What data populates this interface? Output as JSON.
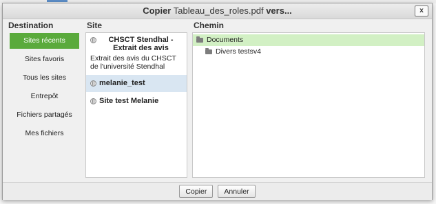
{
  "dialog": {
    "title_action": "Copier",
    "title_file": "Tableau_des_roles.pdf",
    "title_target": "vers...",
    "close_label": "x"
  },
  "columns": {
    "destination": "Destination",
    "site": "Site",
    "chemin": "Chemin"
  },
  "destination_items": [
    {
      "label": "Sites récents",
      "active": true
    },
    {
      "label": "Sites favoris",
      "active": false
    },
    {
      "label": "Tous les sites",
      "active": false
    },
    {
      "label": "Entrepôt",
      "active": false
    },
    {
      "label": "Fichiers partagés",
      "active": false
    },
    {
      "label": "Mes fichiers",
      "active": false
    }
  ],
  "sites": [
    {
      "name": "CHSCT Stendhal - Extrait des avis",
      "description": "Extrait des avis du CHSCT de l'université Stendhal",
      "icon": "site-globe-icon",
      "selected": false
    },
    {
      "name": "melanie_test",
      "description": "",
      "icon": "site-globe-icon",
      "selected": true
    },
    {
      "name": "Site test Melanie",
      "description": "",
      "icon": "site-globe-icon",
      "selected": false
    }
  ],
  "tree": [
    {
      "label": "Documents",
      "icon": "folder-icon",
      "selected": true
    },
    {
      "label": "Divers testsv4",
      "icon": "folder-icon",
      "selected": false
    }
  ],
  "buttons": {
    "copy": "Copier",
    "cancel": "Annuler"
  },
  "colors": {
    "active_destination": "#5aaa3c",
    "selected_site": "#d9e6f2",
    "selected_folder": "#d2f0c4"
  }
}
